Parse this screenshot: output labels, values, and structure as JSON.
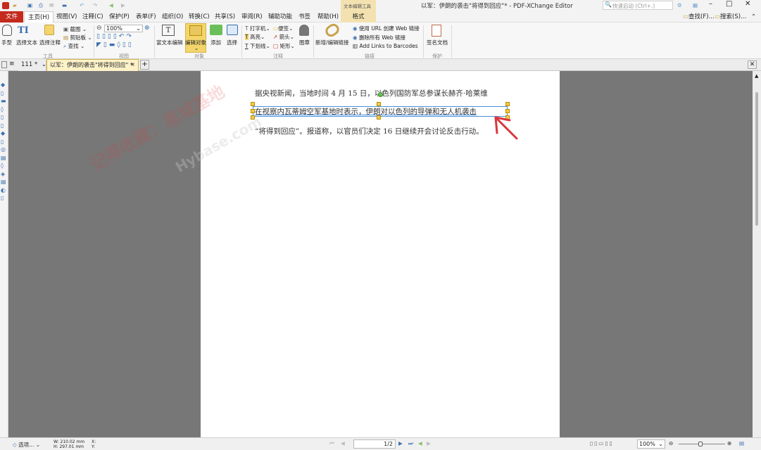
{
  "window": {
    "title": "以军：伊朗的袭击\"将得到回应\"* - PDF-XChange Editor",
    "context_tab": "文本编辑工具",
    "quick_search_placeholder": "快速启动 (Ctrl+.)"
  },
  "menu": {
    "items": [
      "文件",
      "主页(H)",
      "视图(V)",
      "注释(C)",
      "保护(P)",
      "表单(F)",
      "组织(O)",
      "转换(C)",
      "共享(S)",
      "审阅(R)",
      "辅助功能",
      "书签",
      "帮助(H)",
      "格式"
    ],
    "find": "查找(F)...",
    "search": "搜索(S)..."
  },
  "ribbon": {
    "hand": "手型",
    "select_text": "选择文本",
    "select_comment": "选择注释",
    "snapshot": "截图",
    "clipboard": "剪贴板",
    "find": "查找",
    "zoom": "100%",
    "rich_text": "富文本编辑",
    "edit_object": "编辑对象",
    "add": "添加",
    "select": "选择",
    "typewriter": "打字机",
    "sticky": "便签",
    "highlight": "高亮",
    "arrow": "箭头",
    "underline": "下划线",
    "rect": "矩形",
    "stamp": "图章",
    "new_link": "新增/编辑链接",
    "url_link": "使用 URL 创建 Web 链接",
    "remove_links": "删除所有 Web 链接",
    "add_barcodes": "Add Links to Barcodes",
    "sign": "签名文档",
    "groups": {
      "tools": "工具",
      "view": "视图",
      "objects": "对象",
      "comment": "注释",
      "links": "链接",
      "protect": "保护"
    }
  },
  "tabs": [
    {
      "label": "111"
    },
    {
      "label": "以军：伊朗的袭击\"将得到回应\""
    }
  ],
  "document": {
    "line1": "据央视新闻，当地时间 4 月 15 日，以色列国防军总参谋长赫齐·哈莱维",
    "line2": "在视察内瓦蒂姆空军基地时表示，伊朗对以色列的导弹和无人机袭击",
    "line3": "“将得到回应”。报道称，以官员们决定 16 日继续开会讨论反击行动。",
    "watermark1": "记得收藏：黑域基地",
    "watermark2": "Hybase.com"
  },
  "status": {
    "options": "选项...",
    "width": "W: 210.02 mm",
    "height": "H: 297.01 mm",
    "x": "X:",
    "y": "Y:",
    "page": "1/2",
    "zoom": "100%"
  },
  "colors": {
    "accent": "#c42b1c",
    "selection": "#4a90d9",
    "handle": "#f7c948",
    "arrow": "#d9363e"
  }
}
